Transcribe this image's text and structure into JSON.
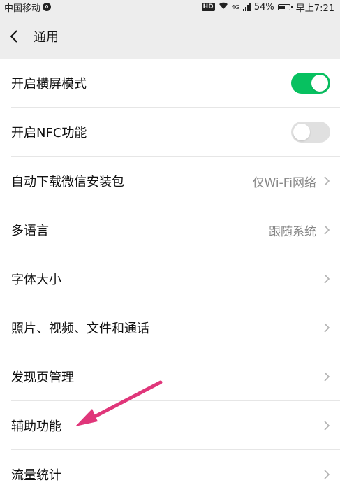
{
  "status_bar": {
    "carrier": "中国移动",
    "hd": "HD",
    "network": "4G",
    "battery": "54%",
    "battery_level": 0.54,
    "time": "早上7:21"
  },
  "header": {
    "title": "通用"
  },
  "settings": [
    {
      "label": "开启横屏模式",
      "type": "toggle",
      "on": true
    },
    {
      "label": "开启NFC功能",
      "type": "toggle",
      "on": false
    },
    {
      "label": "自动下载微信安装包",
      "type": "link",
      "value": "仅Wi-Fi网络"
    },
    {
      "label": "多语言",
      "type": "link",
      "value": "跟随系统"
    },
    {
      "label": "字体大小",
      "type": "link",
      "value": ""
    },
    {
      "label": "照片、视频、文件和通话",
      "type": "link",
      "value": ""
    },
    {
      "label": "发现页管理",
      "type": "link",
      "value": ""
    },
    {
      "label": "辅助功能",
      "type": "link",
      "value": ""
    },
    {
      "label": "流量统计",
      "type": "link",
      "value": ""
    }
  ],
  "colors": {
    "toggle_on": "#07c160",
    "annotation_arrow": "#e0367a"
  }
}
